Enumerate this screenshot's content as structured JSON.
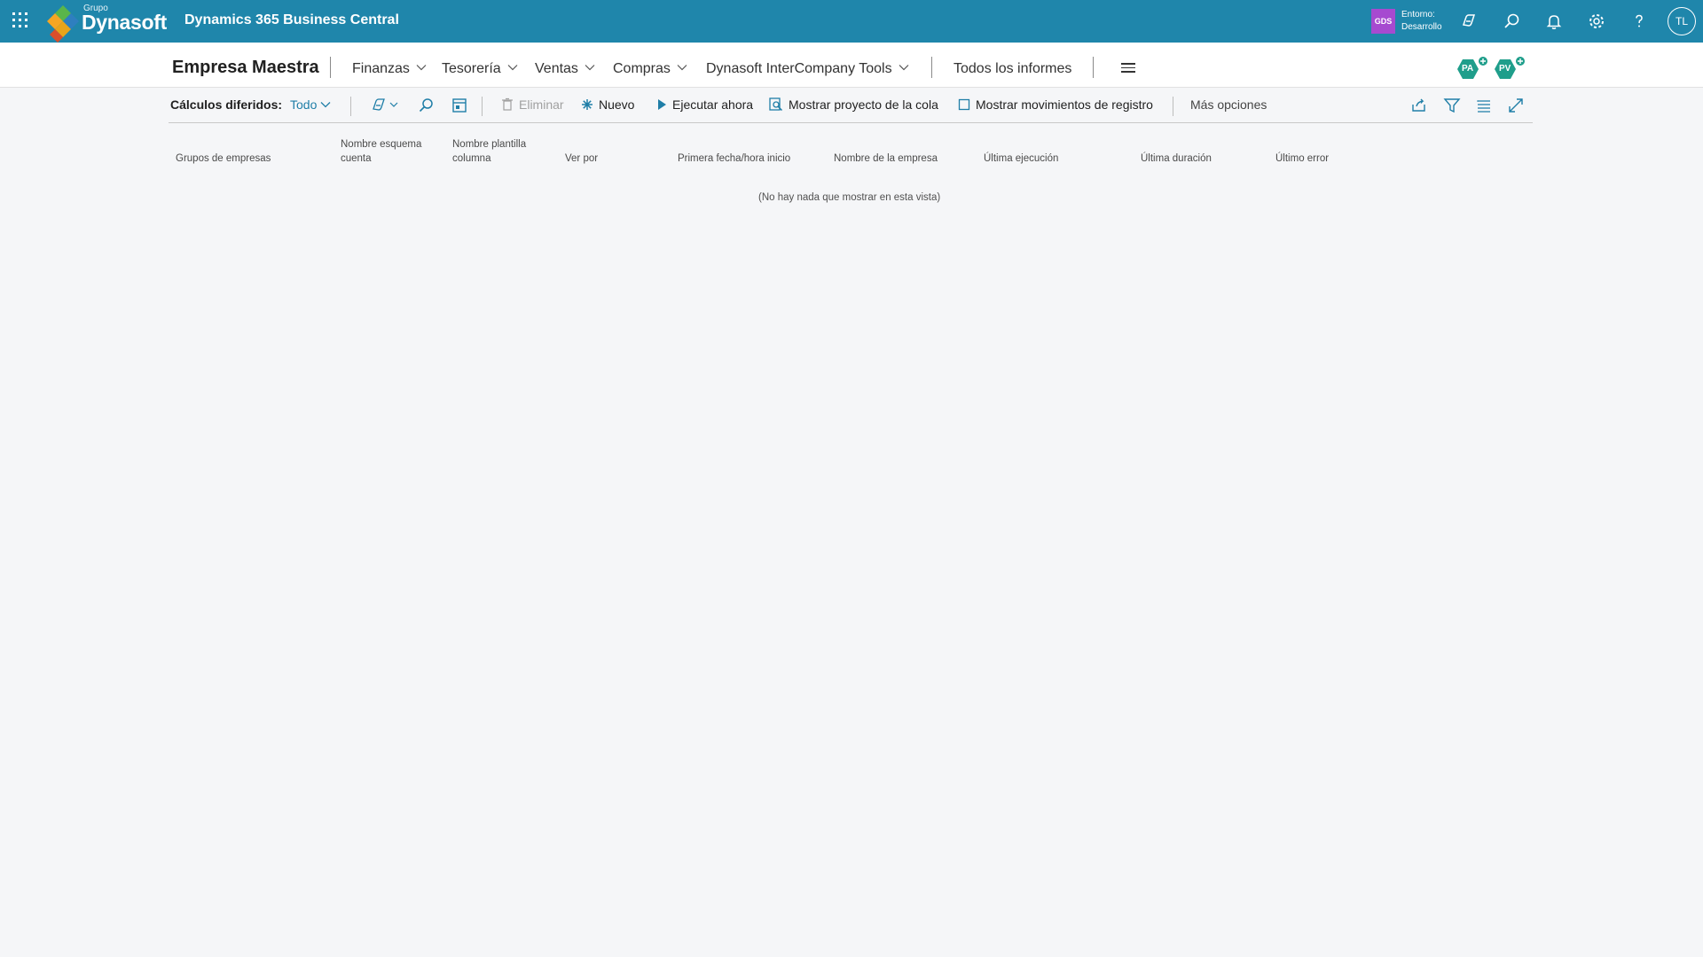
{
  "appbar": {
    "logo_small": "Grupo",
    "logo_name": "Dynasoft",
    "title": "Dynamics 365 Business Central",
    "env_badge": "GDS",
    "env_label": "Entorno:",
    "env_value": "Desarrollo",
    "avatar": "TL",
    "icons": [
      "waffle-icon",
      "copilot-icon",
      "search-icon",
      "bell-icon",
      "gear-icon",
      "help-icon"
    ],
    "colors": {
      "bar": "#1f86ab",
      "badge": "#a64ad0"
    }
  },
  "nav": {
    "company": "Empresa Maestra",
    "menus": [
      {
        "label": "Finanzas"
      },
      {
        "label": "Tesorería"
      },
      {
        "label": "Ventas"
      },
      {
        "label": "Compras"
      },
      {
        "label": "Dynasoft InterCompany Tools"
      }
    ],
    "reports": "Todos los informes",
    "badges": [
      "PA",
      "PV"
    ]
  },
  "actions": {
    "title": "Cálculos diferidos:",
    "view": "Todo",
    "delete": "Eliminar",
    "new": "Nuevo",
    "run_now": "Ejecutar ahora",
    "show_queue": "Mostrar proyecto de la cola",
    "show_log": "Mostrar movimientos de registro",
    "more": "Más opciones"
  },
  "list": {
    "columns": [
      {
        "line1": "Grupos de empresas",
        "line2": ""
      },
      {
        "line1": "Nombre esquema",
        "line2": "cuenta"
      },
      {
        "line1": "Nombre plantilla",
        "line2": "columna"
      },
      {
        "line1": "Ver por",
        "line2": ""
      },
      {
        "line1": "Primera fecha/hora inicio",
        "line2": ""
      },
      {
        "line1": "Nombre de la empresa",
        "line2": ""
      },
      {
        "line1": "Última ejecución",
        "line2": ""
      },
      {
        "line1": "Última duración",
        "line2": ""
      },
      {
        "line1": "Último error",
        "line2": ""
      }
    ],
    "empty_message": "(No hay nada que mostrar en esta vista)"
  }
}
